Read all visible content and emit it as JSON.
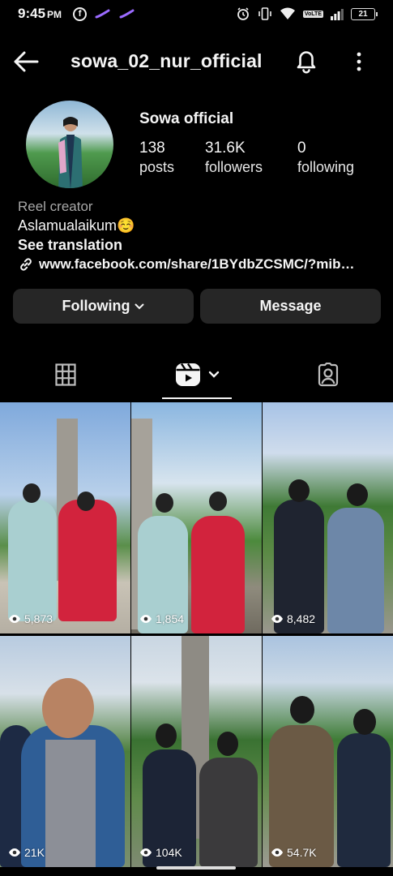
{
  "status_bar": {
    "time": "9:45",
    "ampm": "PM",
    "network": "VoLTE",
    "battery": "21"
  },
  "header": {
    "username": "sowa_02_nur_official",
    "back_icon": "back-arrow-icon",
    "bell_icon": "bell-icon",
    "more_icon": "more-vertical-icon"
  },
  "profile": {
    "display_name": "Sowa official",
    "stats": [
      {
        "value": "138",
        "label": "posts"
      },
      {
        "value": "31.6K",
        "label": "followers"
      },
      {
        "value": "0",
        "label": "following"
      }
    ],
    "category": "Reel creator",
    "bio": "Aslamualaikum☺️",
    "see_translation": "See translation",
    "link": "www.facebook.com/share/1BYdbZCSMC/?mib…"
  },
  "actions": {
    "following_label": "Following",
    "message_label": "Message"
  },
  "tabs": [
    {
      "name": "grid",
      "icon": "grid-icon"
    },
    {
      "name": "reels",
      "icon": "reels-icon",
      "active": true
    },
    {
      "name": "tagged",
      "icon": "tagged-person-icon"
    }
  ],
  "reels": [
    {
      "views": "5,873"
    },
    {
      "views": "1,854"
    },
    {
      "views": "8,482"
    },
    {
      "views": "21K"
    },
    {
      "views": "104K"
    },
    {
      "views": "54.7K"
    }
  ],
  "colors": {
    "background": "#000000",
    "button_bg": "#262626",
    "text": "#f5f5f5",
    "muted": "#a8a8a8"
  }
}
